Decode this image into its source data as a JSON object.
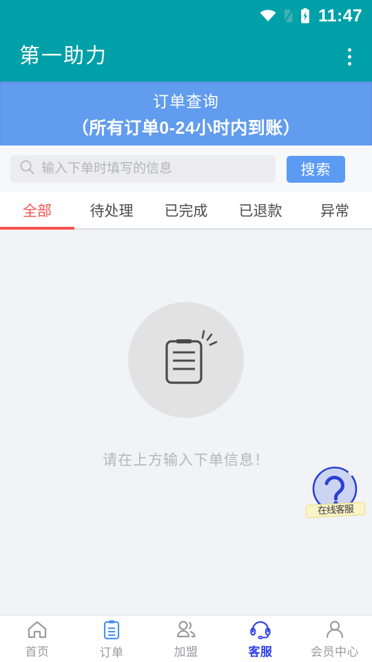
{
  "status_bar": {
    "time": "11:47",
    "icons": [
      "wifi-icon",
      "sim-missing-icon",
      "battery-charging-icon"
    ]
  },
  "app_bar": {
    "title": "第一助力",
    "overflow_icon": "more-vertical-icon"
  },
  "banner": {
    "line1": "订单查询",
    "line2": "（所有订单0-24小时内到账）"
  },
  "search": {
    "placeholder": "输入下单时填写的信息",
    "value": "",
    "icon": "search-icon",
    "button_label": "搜索"
  },
  "tabs": [
    {
      "label": "全部",
      "active": true
    },
    {
      "label": "待处理",
      "active": false
    },
    {
      "label": "已完成",
      "active": false
    },
    {
      "label": "已退款",
      "active": false
    },
    {
      "label": "异常",
      "active": false
    }
  ],
  "empty_state": {
    "icon": "clipboard-empty-icon",
    "message": "请在上方输入下单信息！"
  },
  "floating_help": {
    "icon": "question-mark-icon",
    "label": "在线客服"
  },
  "bottom_nav": [
    {
      "label": "首页",
      "icon": "home-icon",
      "active": false
    },
    {
      "label": "订单",
      "icon": "clipboard-icon",
      "active": false
    },
    {
      "label": "加盟",
      "icon": "users-icon",
      "active": false
    },
    {
      "label": "客服",
      "icon": "headset-icon",
      "active": true
    },
    {
      "label": "会员中心",
      "icon": "person-icon",
      "active": false
    }
  ],
  "colors": {
    "header": "#00a0a8",
    "banner": "#619cee",
    "accent_blue": "#5b9bf3",
    "tab_active": "#f9504b",
    "nav_active": "#2f3fe8",
    "content_bg": "#f2f3f7"
  }
}
